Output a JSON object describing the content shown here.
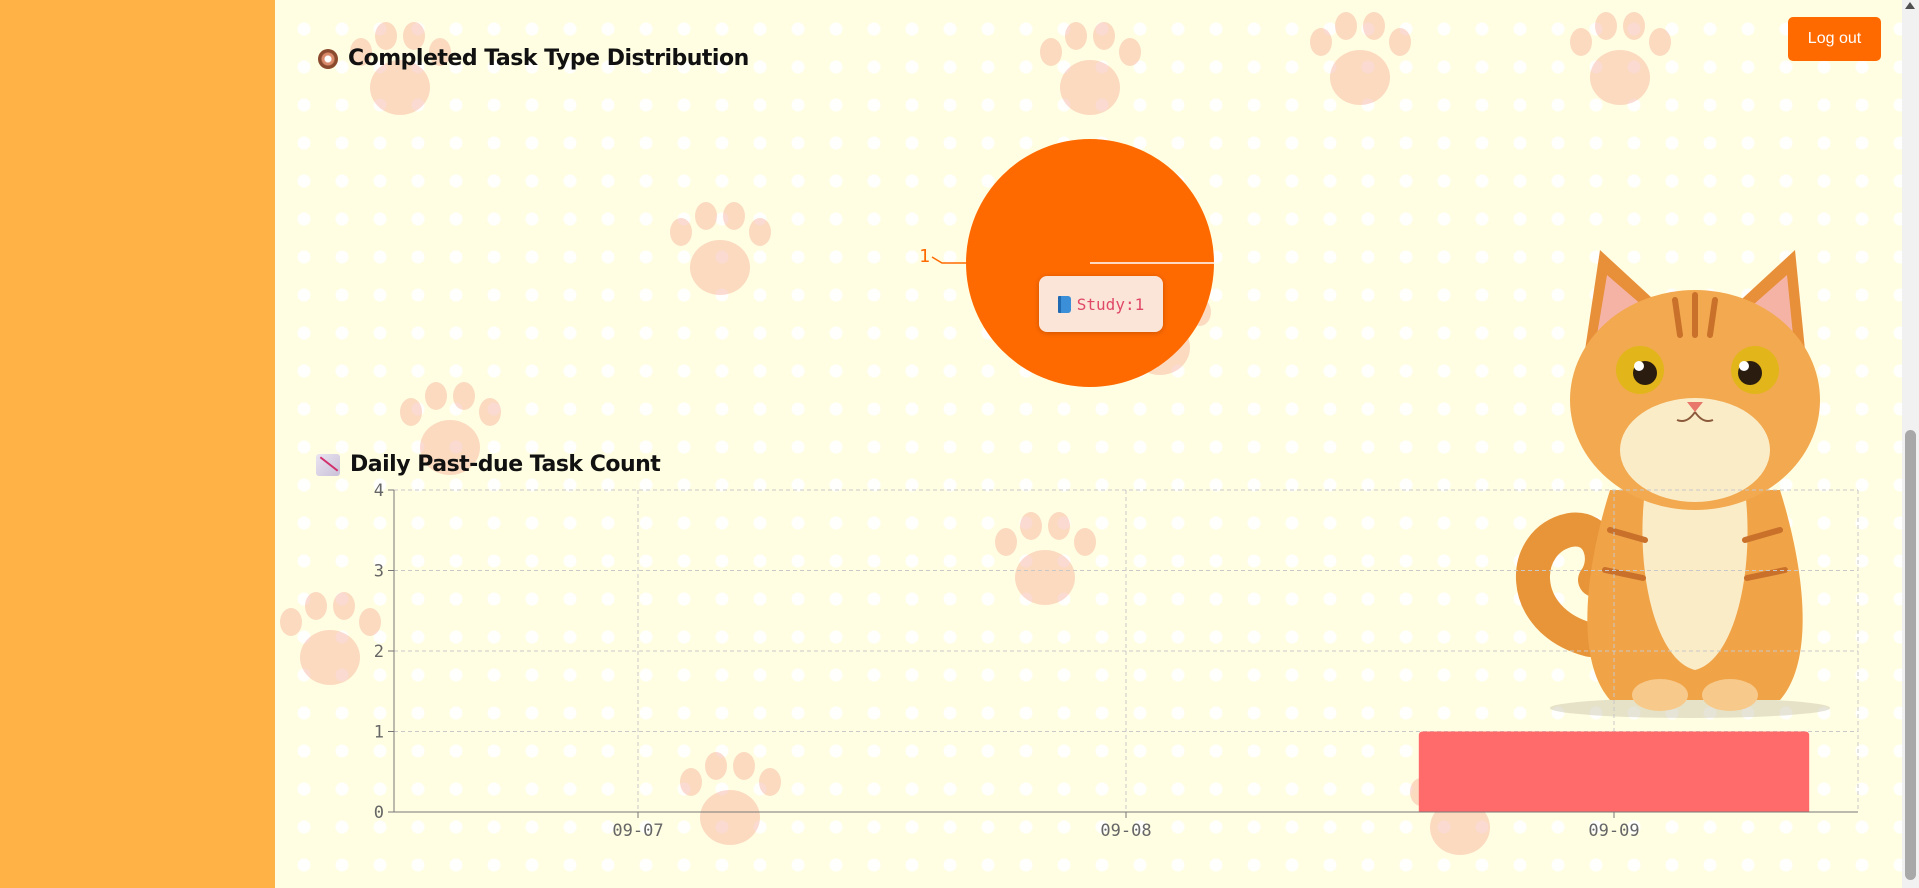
{
  "header": {
    "logout_label": "Log out"
  },
  "sections": {
    "distribution": {
      "title": "Completed Task Type Distribution",
      "icon": "donut-icon"
    },
    "pastdue": {
      "title": "Daily Past-due Task Count",
      "icon": "chart-decreasing-icon"
    }
  },
  "colors": {
    "sidebar": "#ffb347",
    "accent": "#ff6a00",
    "bar": "#ff6b6b",
    "tooltip_text": "#e04868"
  },
  "chart_data": [
    {
      "type": "pie",
      "title": "Completed Task Type Distribution",
      "slices": [
        {
          "name": "Study",
          "value": 1,
          "color": "#ff6a00"
        }
      ],
      "outer_label": "1",
      "tooltip": {
        "icon": "book-icon",
        "text": "Study:1"
      }
    },
    {
      "type": "bar",
      "title": "Daily Past-due Task Count",
      "categories": [
        "09-07",
        "09-08",
        "09-09"
      ],
      "values": [
        0,
        0,
        1
      ],
      "ylim": [
        0,
        4
      ],
      "yticks": [
        "0",
        "1",
        "2",
        "3",
        "4"
      ],
      "grid": true,
      "bar_color": "#ff6b6b"
    }
  ]
}
